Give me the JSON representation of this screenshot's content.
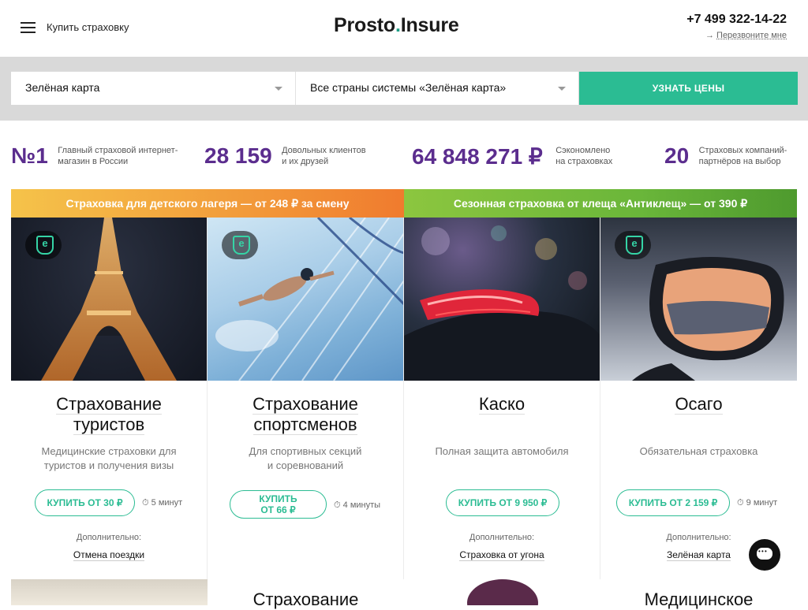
{
  "header": {
    "menu_label": "Купить страховку",
    "logo_text_main": "Prosto",
    "logo_text_dot": ".",
    "logo_text_end": "Insure",
    "phone": "+7 499 322-14-22",
    "callback": "Перезвоните мне",
    "callback_arrow": "→"
  },
  "search": {
    "type_value": "Зелёная карта",
    "country_value": "Все страны системы «Зелёная карта»",
    "submit_label": "УЗНАТЬ ЦЕНЫ"
  },
  "stats": [
    {
      "value": "№1",
      "label_line1": "Главный страховой интернет-",
      "label_line2": "магазин в России"
    },
    {
      "value": "28 159",
      "label_line1": "Довольных клиентов",
      "label_line2": "и их друзей"
    },
    {
      "value": "64 848 271 ₽",
      "label_line1": "Сэкономлено",
      "label_line2": "на страховках"
    },
    {
      "value": "20",
      "label_line1": "Страховых компаний-",
      "label_line2": "партнёров на выбор"
    }
  ],
  "banners": [
    {
      "text": "Страховка для детского лагеря — от 248 ₽ за смену"
    },
    {
      "text": "Сезонная страховка от клеща «Антиклещ» — от 390 ₽"
    }
  ],
  "cards": [
    {
      "title_line1": "Страхование",
      "title_line2": "туристов",
      "desc_line1": "Медицинские страховки для",
      "desc_line2": "туристов и получения визы",
      "buy_line1": "КУПИТЬ ОТ 30 ₽",
      "buy_line2": "",
      "time": "5 минут",
      "extra_label": "Дополнительно:",
      "extra_link": "Отмена поездки",
      "has_badge": true
    },
    {
      "title_line1": "Страхование",
      "title_line2": "спортсменов",
      "desc_line1": "Для спортивных секций",
      "desc_line2": "и соревнований",
      "buy_line1": "КУПИТЬ",
      "buy_line2": "ОТ 66 ₽",
      "time": "4 минуты",
      "extra_label": "",
      "extra_link": "",
      "has_badge": true
    },
    {
      "title_line1": "Каско",
      "title_line2": "",
      "desc_line1": "Полная защита автомобиля",
      "desc_line2": "",
      "buy_line1": "КУПИТЬ ОТ 9 950 ₽",
      "buy_line2": "",
      "time": "",
      "extra_label": "Дополнительно:",
      "extra_link": "Страховка от угона",
      "has_badge": false
    },
    {
      "title_line1": "Осаго",
      "title_line2": "",
      "desc_line1": "Обязательная страховка",
      "desc_line2": "",
      "buy_line1": "КУПИТЬ ОТ 2 159 ₽",
      "buy_line2": "",
      "time": "9 минут",
      "extra_label": "Дополнительно:",
      "extra_link": "Зелёная карта",
      "has_badge": true
    }
  ],
  "next_row": {
    "title_2": "Страхование",
    "title_4": "Медицинское"
  },
  "colors": {
    "accent": "#2bbc93",
    "stat_purple": "#5b2d8e"
  }
}
